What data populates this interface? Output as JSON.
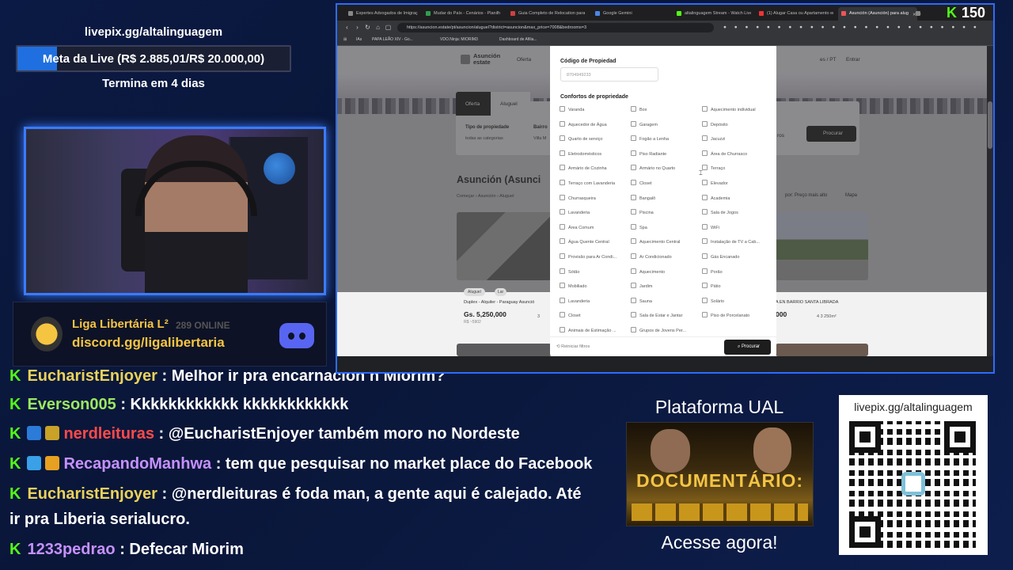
{
  "stream": {
    "livepix_top": "livepix.gg/altalinguagem",
    "goal_text": "Meta da Live (R$ 2.885,01/R$ 20.000,00)",
    "goal_progress": 0.144,
    "goal_ends": "Termina em 4 dias",
    "discord_line1": "Liga Libertária L²",
    "discord_online": "289 ONLINE",
    "discord_line2": "discord.gg/ligalibertaria",
    "ual_title": "Plataforma UAL",
    "ual_banner": "DOCUMENTÁRIO:",
    "ual_cta": "Acesse agora!",
    "qr_url": "livepix.gg/altalinguagem"
  },
  "chat": [
    {
      "user": "EucharistEnjoyer",
      "text": ": Melhor ir pra encarnación n Miorim?",
      "color": "u-yellow",
      "badges": []
    },
    {
      "user": "Everson005",
      "text": ": Kkkkkkkkkkkk kkkkkkkkkkkk",
      "color": "u-green",
      "badges": []
    },
    {
      "user": "nerdleituras",
      "text": ": @EucharistEnjoyer também moro no Nordeste",
      "color": "u-red",
      "badges": [
        "#2b7bd8",
        "#c9a227"
      ]
    },
    {
      "user": "RecapandoManhwa",
      "text": ": tem que pesquisar no market place do Facebook",
      "color": "u-purple",
      "badges": [
        "#3aa0e8",
        "#e8a020"
      ]
    },
    {
      "user": "EucharistEnjoyer",
      "text": ": @nerdleituras é foda man, a gente aqui é calejado. Até",
      "color": "u-yellow",
      "badges": []
    },
    {
      "user": "",
      "text": "ir pra Liberia serialucro.",
      "color": "",
      "badges": [],
      "continuation": true
    },
    {
      "user": "1233pedrao",
      "text": ": Defecar Miorim",
      "color": "u-purple",
      "badges": []
    }
  ],
  "browser": {
    "tabs": [
      {
        "label": "Expertes Advogados de Imigraç",
        "fav": "#888"
      },
      {
        "label": "Mudar do País - Cenários - Planilha",
        "fav": "#2e9e4e"
      },
      {
        "label": "Guia Completo de Relocation para I",
        "fav": "#d04040"
      },
      {
        "label": "Google Gemini",
        "fav": "#4a86e8"
      },
      {
        "label": "altalinguagem Stream - Watch Live",
        "fav": "#53fc18"
      },
      {
        "label": "(1) Alugar Casa ou Apartamento em",
        "fav": "#e33"
      },
      {
        "label": "Asunción (Asunción) para alug",
        "fav": "#e55",
        "active": true
      }
    ],
    "kick_viewers": "150",
    "url": "https://asuncion.estate/pt/asuncion/aluguel?district=asuncion&max_price=7008&bedrooms=3",
    "bookmarks": [
      "IAs",
      "PAPA LEÃO XIV - Go...",
      "VDO.Ninja: MIORIM3",
      "Dashboard de Afilia..."
    ]
  },
  "site": {
    "logo": "Asunción\nestate",
    "offer_menu": "Oferta",
    "lang": "es / PT",
    "login": "Entrar",
    "tab_oferta": "Oferta",
    "tab_aluguel": "Aluguel",
    "tipo_label": "Tipo de propiedade",
    "tipo_value": "todas as categorias",
    "bairro_label": "Bairro",
    "bairro_value": "Villa M",
    "filters_suffix": "ros",
    "search_button": "Procurar",
    "title": "Asunción (Asunci",
    "breadcrumb": "Começar  ›  Asunción  ›  Aluguel",
    "sort": "por: Preço mais alto",
    "map": "Mapa",
    "card1": {
      "pill1": "Aluguel",
      "pill2": "Lar",
      "title": "Duplex - Alquiler - Paraguay Asunció",
      "price": "Gs. 5,250,000",
      "sub": "R$ ~5902",
      "beds": "3"
    },
    "card2": {
      "title": "A EN BARRIO SANTA LIBRADA",
      "price": "000",
      "specs": "4   3   250m²"
    }
  },
  "modal": {
    "code_label": "Código de Propiedad",
    "code_placeholder": "8704949233",
    "amenities_label": "Confortos de propriedade",
    "col1": [
      "Varanda",
      "Aquecedor de Água",
      "Quarto de serviço",
      "Eletrodomésticos",
      "Armário de Cozinha",
      "Terraço com Lavanderia",
      "Churrasqueira",
      "Lavanderia",
      "Área Comum",
      "Água Quente Central",
      "Provisão para Ar Condi...",
      "Sótão",
      "Mobiliado",
      "Lavanderia",
      "Closet",
      "Animais de Estimação ..."
    ],
    "col2": [
      "Box",
      "Garagem",
      "Fogão a Lenha",
      "Piso Radiante",
      "Armário no Quarto",
      "Closet",
      "Bangalô",
      "Piscina",
      "Spa",
      "Aquecimento Central",
      "Ar Condicionado",
      "Aquecimento",
      "Jardim",
      "Sauna",
      "Sala de Estar e Jantar",
      "Grupos de Jovens Per..."
    ],
    "col3": [
      "Aquecimento individual",
      "Depósito",
      "Jacuzzi",
      "Área de Churrasco",
      "Terraço",
      "Elevador",
      "Academia",
      "Sala de Jogos",
      "WiFi",
      "Instalação de TV a Cab...",
      "Gás Encanado",
      "Porão",
      "Pátio",
      "Solário",
      "Piso de Porcelanato"
    ],
    "reset": "Reiniciar filtros",
    "submit": "Procurar"
  }
}
